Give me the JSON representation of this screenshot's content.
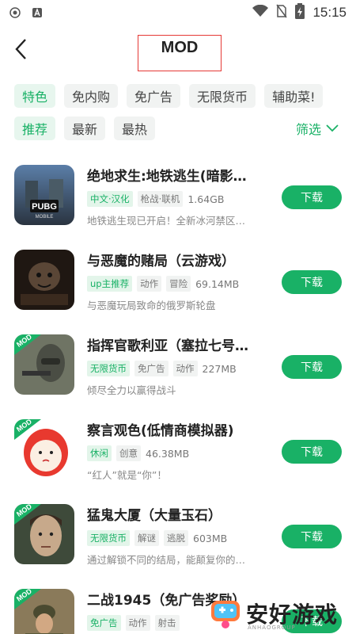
{
  "status_bar": {
    "time": "15:15"
  },
  "header": {
    "title": "MOD"
  },
  "category_chips": [
    {
      "label": "特色",
      "active": true
    },
    {
      "label": "免内购",
      "active": false
    },
    {
      "label": "免广告",
      "active": false
    },
    {
      "label": "无限货币",
      "active": false
    },
    {
      "label": "辅助菜!",
      "active": false
    }
  ],
  "sort_chips": [
    {
      "label": "推荐",
      "active": true
    },
    {
      "label": "最新",
      "active": false
    },
    {
      "label": "最热",
      "active": false
    }
  ],
  "filter_label": "筛选",
  "games": [
    {
      "name": "绝地求生:地铁逃生(暗影…",
      "tags": [
        "中文·汉化",
        "枪战·联机"
      ],
      "size": "1.64GB",
      "desc": "地铁逃生现已开启！全新冰河禁区…",
      "button": "下载",
      "icon": "pubg-icon"
    },
    {
      "name": "与恶魔的赌局（云游戏）",
      "tags": [
        "up主推荐",
        "动作",
        "冒险"
      ],
      "size": "69.14MB",
      "desc": "与恶魔玩局致命的俄罗斯轮盘",
      "button": "下载",
      "icon": "devil-gamble-icon"
    },
    {
      "name": "指挥官歌利亚（塞拉七号…",
      "tags": [
        "无限货币",
        "免广告",
        "动作"
      ],
      "size": "227MB",
      "desc": "倾尽全力以赢得战斗",
      "button": "下载",
      "icon": "commander-icon",
      "mod": "MOD"
    },
    {
      "name": "察言观色(低情商模拟器)",
      "tags": [
        "休闲",
        "创意"
      ],
      "size": "46.38MB",
      "desc": "“红人”就是“你”！",
      "button": "下载",
      "icon": "doll-face-icon",
      "mod": "MOD"
    },
    {
      "name": "猛鬼大厦（大量玉石）",
      "tags": [
        "无限货币",
        "解谜",
        "逃脱"
      ],
      "size": "603MB",
      "desc": "通过解锁不同的结局，能颠复你的…",
      "button": "下载",
      "icon": "ghost-mansion-icon",
      "mod": "MOD"
    },
    {
      "name": "二战1945（免广告奖励）",
      "tags": [
        "免广告",
        "动作",
        "射击"
      ],
      "size": "",
      "desc": "",
      "button": "下载",
      "icon": "ww2-icon",
      "mod": "MOD"
    }
  ],
  "watermark": {
    "text": "安好游戏",
    "sub": "ANHAOGROUP"
  },
  "colors": {
    "accent": "#19b166",
    "chip_bg": "#f1f3f2",
    "highlight_border": "#e53935"
  }
}
